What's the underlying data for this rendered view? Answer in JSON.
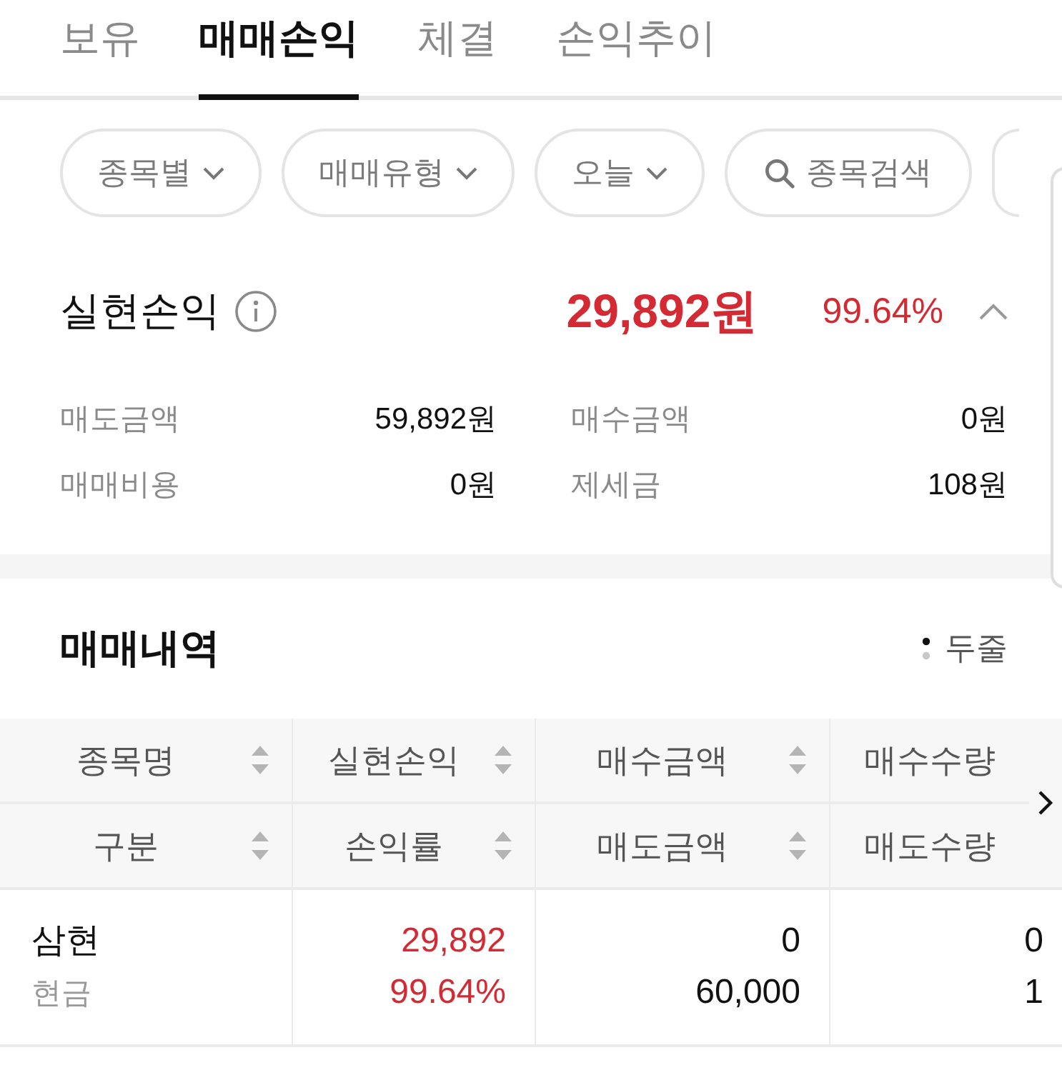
{
  "tabs": [
    {
      "label": "보유",
      "selected": false
    },
    {
      "label": "매매손익",
      "selected": true
    },
    {
      "label": "체결",
      "selected": false
    },
    {
      "label": "손익추이",
      "selected": false
    }
  ],
  "filters": [
    {
      "kind": "dropdown",
      "label": "종목별"
    },
    {
      "kind": "dropdown",
      "label": "매매유형"
    },
    {
      "kind": "dropdown",
      "label": "오늘"
    },
    {
      "kind": "search",
      "label": "종목검색"
    },
    {
      "kind": "clipped"
    }
  ],
  "summary": {
    "title": "실현손익",
    "amount": "29,892원",
    "rate": "99.64%",
    "gain": true,
    "expanded": true,
    "items": [
      {
        "label": "매도금액",
        "value": "59,892원"
      },
      {
        "label": "매수금액",
        "value": "0원"
      },
      {
        "label": "매매비용",
        "value": "0원"
      },
      {
        "label": "제세금",
        "value": "108원"
      }
    ]
  },
  "history": {
    "title": "매매내역",
    "view_toggle": "두줄",
    "columns": [
      {
        "top": "종목명",
        "bottom": "구분",
        "sortable": true
      },
      {
        "top": "실현손익",
        "bottom": "손익률",
        "sortable": true
      },
      {
        "top": "매수금액",
        "bottom": "매도금액",
        "sortable": true
      },
      {
        "top": "매수수량",
        "bottom": "매도수량",
        "sortable": false
      }
    ],
    "rows": [
      {
        "name": "삼현",
        "type": "현금",
        "profit": "29,892",
        "rate": "99.64%",
        "gain": true,
        "buy_amount": "0",
        "sell_amount": "60,000",
        "buy_qty": "0",
        "sell_qty": "1"
      }
    ]
  }
}
